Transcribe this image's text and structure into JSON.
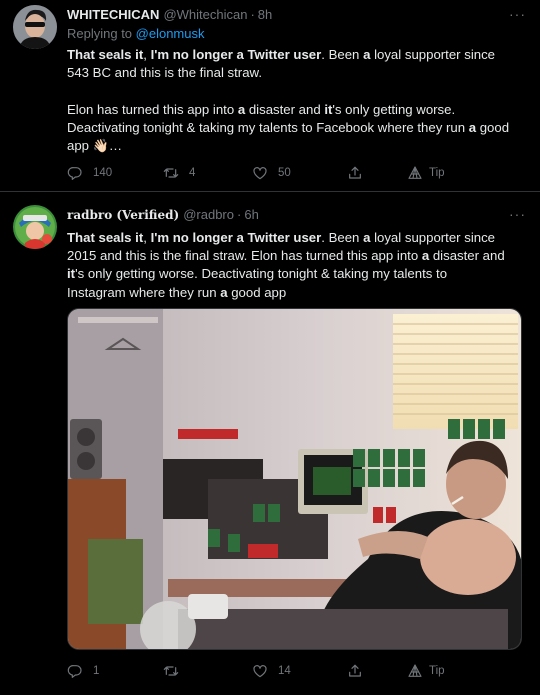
{
  "tweets": [
    {
      "display_name": "WHITECHICAN",
      "handle": "@Whitechican",
      "separator": "·",
      "time": "8h",
      "reply_prefix": "Replying to ",
      "reply_mention": "@elonmusk",
      "text_segments": [
        {
          "t": "That seals it",
          "b": true
        },
        {
          "t": ", ",
          "b": false
        },
        {
          "t": "I'm no longer a Twitter user",
          "b": true
        },
        {
          "t": ". Been ",
          "b": false
        },
        {
          "t": "a",
          "b": true
        },
        {
          "t": " loyal supporter since\n543 BC and this is the final straw.\n\nElon has turned this app into ",
          "b": false
        },
        {
          "t": "a",
          "b": true
        },
        {
          "t": " disaster and ",
          "b": false
        },
        {
          "t": "it",
          "b": true
        },
        {
          "t": "'s only getting worse.\nDeactivating tonight & taking my talents to Facebook where they run ",
          "b": false
        },
        {
          "t": "a",
          "b": true
        },
        {
          "t": " good\napp ",
          "b": false
        }
      ],
      "text_emoji": "👋🏻",
      "text_suffix": "…",
      "reply_count": "140",
      "retweet_count": "4",
      "like_count": "50",
      "tip_label": "Tip"
    },
    {
      "display_name": "radbro (Verified)",
      "handle": "@radbro",
      "separator": "·",
      "time": "6h",
      "text_segments": [
        {
          "t": "That seals it",
          "b": true
        },
        {
          "t": ", ",
          "b": false
        },
        {
          "t": "I'm no longer a Twitter user",
          "b": true
        },
        {
          "t": ". Been ",
          "b": false
        },
        {
          "t": "a",
          "b": true
        },
        {
          "t": " loyal supporter since\n2015 and this is the final straw. Elon has turned this app into ",
          "b": false
        },
        {
          "t": "a",
          "b": true
        },
        {
          "t": " disaster and\n",
          "b": false
        },
        {
          "t": "it",
          "b": true
        },
        {
          "t": "'s only getting worse. Deactivating tonight & taking my talents to\nInstagram where they run ",
          "b": false
        },
        {
          "t": "a",
          "b": true
        },
        {
          "t": " good app",
          "b": false
        }
      ],
      "reply_count": "1",
      "retweet_count": "",
      "like_count": "14",
      "tip_label": "Tip"
    }
  ],
  "more_label": "···",
  "icons": {
    "more": "more-dots-icon",
    "reply": "reply-icon",
    "retweet": "retweet-icon",
    "like": "heart-icon",
    "share": "share-icon",
    "tip": "tip-icon"
  },
  "colors": {
    "background": "#000000",
    "text": "#e7e9ea",
    "secondary": "#71767b",
    "link": "#1d9bf0",
    "divider": "#2f3336"
  }
}
